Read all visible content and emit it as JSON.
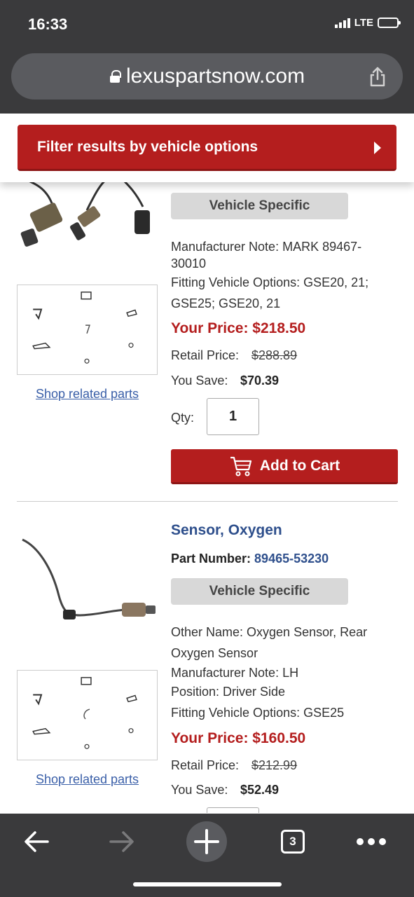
{
  "status_bar": {
    "time": "16:33",
    "network": "LTE"
  },
  "browser": {
    "url": "lexuspartsnow.com",
    "tab_count": "3"
  },
  "filter": {
    "label": "Filter results by vehicle options"
  },
  "products": [
    {
      "badge": "Vehicle Specific",
      "notes": [
        "Manufacturer Note: MARK 89467-",
        "30010",
        "Fitting Vehicle Options: GSE20, 21;",
        "GSE25; GSE20, 21"
      ],
      "your_price": "Your Price: $218.50",
      "retail_label": "Retail Price:",
      "retail_value": "$288.89",
      "save_label": "You Save:",
      "save_value": "$70.39",
      "qty_label": "Qty:",
      "qty_value": "1",
      "cart_label": "Add to Cart",
      "shop_link": "Shop related parts"
    },
    {
      "title": "Sensor, Oxygen",
      "part_number_label": "Part Number:",
      "part_number": "89465-53230",
      "badge": "Vehicle Specific",
      "notes": [
        "Other Name: Oxygen Sensor, Rear",
        "Oxygen Sensor",
        "Manufacturer Note: LH",
        "Position: Driver Side",
        "Fitting Vehicle Options: GSE25"
      ],
      "your_price": "Your Price: $160.50",
      "retail_label": "Retail Price:",
      "retail_value": "$212.99",
      "save_label": "You Save:",
      "save_value": "$52.49",
      "shop_link": "Shop related parts"
    }
  ],
  "colors": {
    "brand_red": "#b41e1e",
    "link_blue": "#2e4f8c",
    "chrome": "#3a3a3c"
  },
  "icons": [
    "lock-icon",
    "share-icon",
    "chevron-right-icon",
    "cart-icon",
    "back-icon",
    "forward-icon",
    "new-tab-icon",
    "tabs-icon",
    "more-icon"
  ]
}
